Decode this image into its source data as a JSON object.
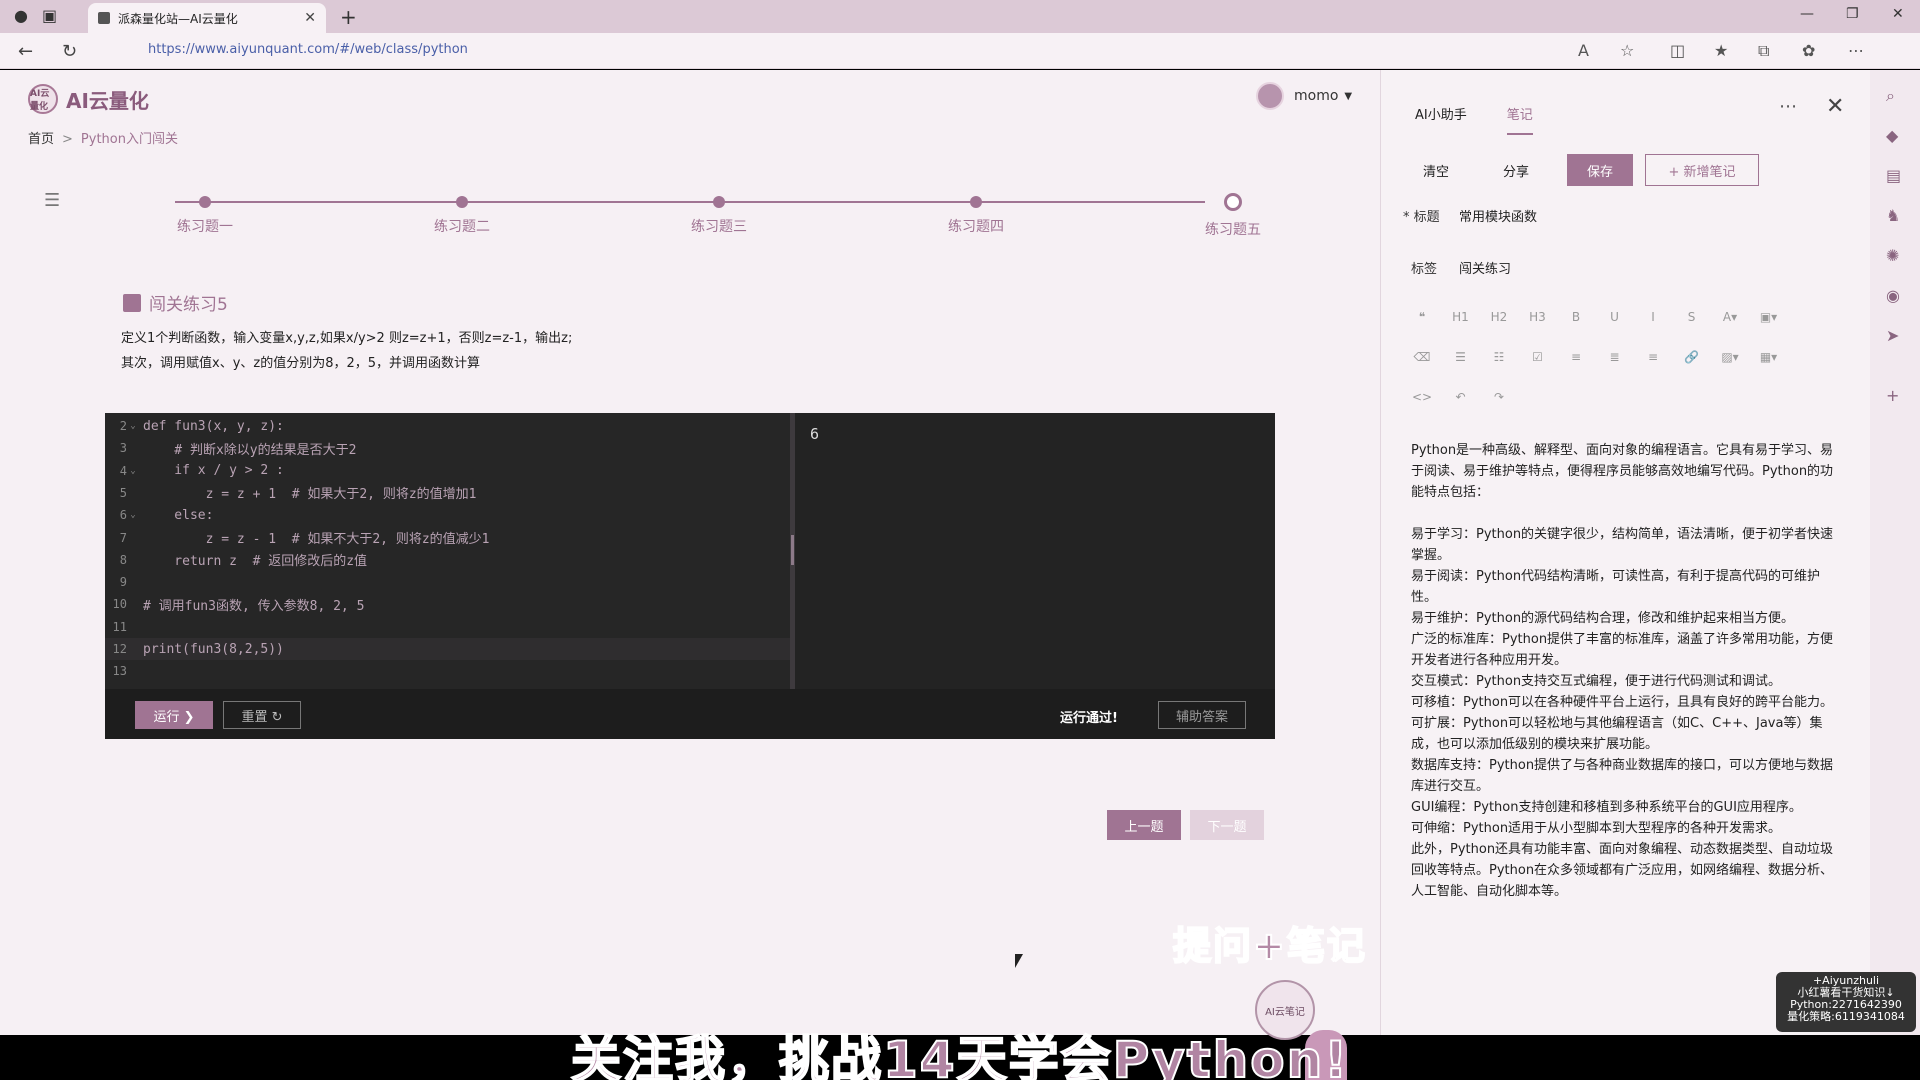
{
  "browser": {
    "tab_title": "派森量化站—AI云量化",
    "url": "https://www.aiyunquant.com/#/web/class/python"
  },
  "site": {
    "logo_text": "AI云量化",
    "logo_mark": "AI云量化",
    "user_name": "momo",
    "breadcrumb_home": "首页",
    "breadcrumb_current": "Python入门闯关"
  },
  "steps": [
    "练习题一",
    "练习题二",
    "练习题三",
    "练习题四",
    "练习题五"
  ],
  "question": {
    "title": "闯关练习5",
    "desc_line1": "定义1个判断函数，输入变量x,y,z,如果x/y>2 则z=z+1，否则z=z-1，输出z;",
    "desc_line2": "其次，调用赋值x、y、z的值分别为8，2，5，并调用函数计算"
  },
  "code_lines": [
    {
      "n": "2",
      "fold": "⌄",
      "text": "def fun3(x, y, z):"
    },
    {
      "n": "3",
      "fold": "",
      "text": "    # 判断x除以y的结果是否大于2"
    },
    {
      "n": "4",
      "fold": "⌄",
      "text": "    if x / y > 2 :"
    },
    {
      "n": "5",
      "fold": "",
      "text": "        z = z + 1  # 如果大于2, 则将z的值增加1"
    },
    {
      "n": "6",
      "fold": "⌄",
      "text": "    else:"
    },
    {
      "n": "7",
      "fold": "",
      "text": "        z = z - 1  # 如果不大于2, 则将z的值减少1"
    },
    {
      "n": "8",
      "fold": "",
      "text": "    return z  # 返回修改后的z值"
    },
    {
      "n": "9",
      "fold": "",
      "text": ""
    },
    {
      "n": "10",
      "fold": "",
      "text": "# 调用fun3函数, 传入参数8, 2, 5"
    },
    {
      "n": "11",
      "fold": "",
      "text": ""
    },
    {
      "n": "12",
      "fold": "",
      "text": "print(fun3(8,2,5))"
    },
    {
      "n": "13",
      "fold": "",
      "text": ""
    }
  ],
  "editor": {
    "output": "6",
    "run_label": "运行 ❯",
    "reset_label": "重置 ↻",
    "pass_text": "运行通过!",
    "help_label": "辅助答案"
  },
  "nav": {
    "prev_label": "上一题",
    "next_label": "下一题"
  },
  "overlay": {
    "promo": "提问+笔记",
    "robot_label": "AI云笔记",
    "subtitle": "关注我，挑战14天学会Python!",
    "watermark": [
      "+Aiyunzhuli",
      "小红薯看干货知识↓",
      "Python:2271642390",
      "量化策略:6119341084"
    ]
  },
  "panel": {
    "tab_ai": "AI小助手",
    "tab_notes": "笔记",
    "btn_clear": "清空",
    "btn_share": "分享",
    "btn_save": "保存",
    "btn_new": "+ 新增笔记",
    "title_label": "* 标题",
    "title_value": "常用模块函数",
    "tag_label": "标签",
    "tag_value": "闯关练习",
    "toolbar": [
      "❝",
      "H1",
      "H2",
      "H3",
      "B",
      "U",
      "I",
      "S",
      "A▾",
      "▣▾",
      "⌫",
      "☰",
      "☷",
      "☑",
      "≡",
      "≣",
      "≡",
      "🔗",
      "▨▾",
      "▦▾",
      "<>",
      "↶",
      "↷"
    ],
    "content": [
      "Python是一种高级、解释型、面向对象的编程语言。它具有易于学习、易于阅读、易于维护等特点，便得程序员能够高效地编写代码。Python的功能特点包括：",
      "",
      "易于学习：Python的关键字很少，结构简单，语法清晰，便于初学者快速掌握。",
      "易于阅读：Python代码结构清晰，可读性高，有利于提高代码的可维护性。",
      "易于维护：Python的源代码结构合理，修改和维护起来相当方便。",
      "广泛的标准库：Python提供了丰富的标准库，涵盖了许多常用功能，方便开发者进行各种应用开发。",
      "交互模式：Python支持交互式编程，便于进行代码测试和调试。",
      "可移植：Python可以在各种硬件平台上运行，且具有良好的跨平台能力。",
      "可扩展：Python可以轻松地与其他编程语言（如C、C++、Java等）集成，也可以添加低级别的模块来扩展功能。",
      "数据库支持：Python提供了与各种商业数据库的接口，可以方便地与数据库进行交互。",
      "GUI编程：Python支持创建和移植到多种系统平台的GUI应用程序。",
      "可伸缩：Python适用于从小型脚本到大型程序的各种开发需求。",
      "此外，Python还具有功能丰富、面向对象编程、动态数据类型、自动垃圾回收等特点。Python在众多领域都有广泛应用，如网络编程、数据分析、人工智能、自动化脚本等。"
    ]
  },
  "colors": {
    "accent": "#a07493",
    "editor_bg": "#262626"
  }
}
